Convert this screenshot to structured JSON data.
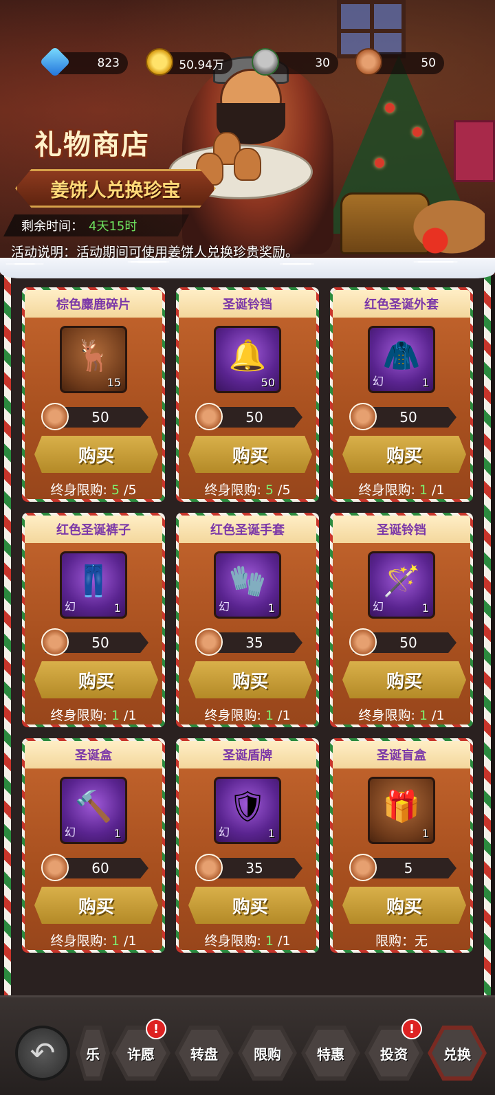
{
  "resources": [
    {
      "icon": "diamond-icon",
      "value": "823"
    },
    {
      "icon": "gold-coin-icon",
      "value": "50.94万"
    },
    {
      "icon": "christmas-bell-icon",
      "value": "30"
    },
    {
      "icon": "gingerbread-cookie-icon",
      "value": "50"
    }
  ],
  "header": {
    "title": "礼物商店",
    "subtitle": "姜饼人兑换珍宝",
    "timer_label": "剩余时间：",
    "timer_value": "4天15时",
    "description": "活动说明：活动期间可使用姜饼人兑换珍贵奖励。"
  },
  "shop": {
    "buy_label": "购买",
    "limit_label": "终身限购:",
    "items": [
      {
        "name": "棕色麋鹿碎片",
        "count": "15",
        "tag": "",
        "price": "50",
        "bought": "5",
        "total": "/5",
        "art": "reindeer-icon"
      },
      {
        "name": "圣诞铃铛",
        "count": "50",
        "tag": "",
        "price": "50",
        "bought": "5",
        "total": "/5",
        "art": "bell-icon"
      },
      {
        "name": "红色圣诞外套",
        "count": "1",
        "tag": "幻",
        "price": "50",
        "bought": "1",
        "total": "/1",
        "art": "santa-coat-icon"
      },
      {
        "name": "红色圣诞裤子",
        "count": "1",
        "tag": "幻",
        "price": "50",
        "bought": "1",
        "total": "/1",
        "art": "santa-pants-icon"
      },
      {
        "name": "红色圣诞手套",
        "count": "1",
        "tag": "幻",
        "price": "35",
        "bought": "1",
        "total": "/1",
        "art": "santa-gloves-icon"
      },
      {
        "name": "圣诞铃铛",
        "count": "1",
        "tag": "幻",
        "price": "50",
        "bought": "1",
        "total": "/1",
        "art": "bell-scepter-icon"
      },
      {
        "name": "圣诞盒",
        "count": "1",
        "tag": "幻",
        "price": "60",
        "bought": "1",
        "total": "/1",
        "art": "candy-hammer-icon"
      },
      {
        "name": "圣诞盾牌",
        "count": "1",
        "tag": "幻",
        "price": "35",
        "bought": "1",
        "total": "/1",
        "art": "wreath-shield-icon"
      },
      {
        "name": "圣诞盲盒",
        "count": "1",
        "tag": "",
        "price": "5",
        "limit_text": "限购：无",
        "art": "lucky-bag-icon"
      }
    ]
  },
  "nav": {
    "back_icon": "back-arrow-icon",
    "partial_label": "乐",
    "items": [
      {
        "label": "许愿",
        "badge": "!"
      },
      {
        "label": "转盘",
        "badge": ""
      },
      {
        "label": "限购",
        "badge": ""
      },
      {
        "label": "特惠",
        "badge": ""
      },
      {
        "label": "投资",
        "badge": "!"
      },
      {
        "label": "兑换",
        "badge": ""
      }
    ]
  }
}
